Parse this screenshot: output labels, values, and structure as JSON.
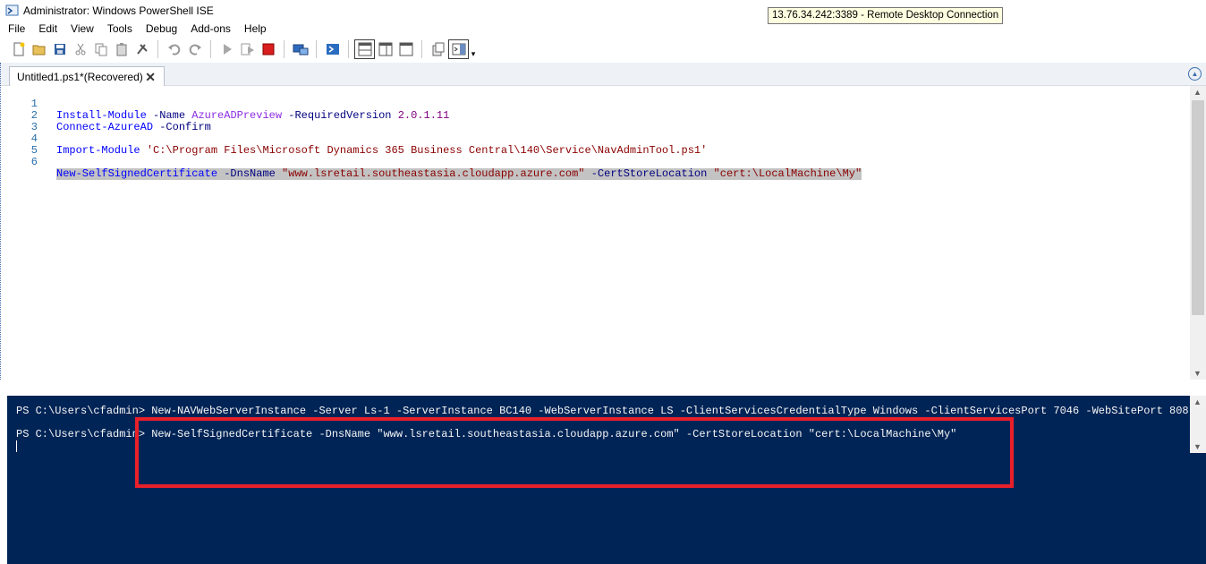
{
  "window": {
    "title": "Administrator: Windows PowerShell ISE",
    "tooltip": "13.76.34.242:3389 - Remote Desktop Connection"
  },
  "menu": [
    "File",
    "Edit",
    "View",
    "Tools",
    "Debug",
    "Add-ons",
    "Help"
  ],
  "toolbar": {
    "icons": [
      "new-file-icon",
      "open-folder-icon",
      "save-icon",
      "cut-icon",
      "copy-icon",
      "paste-icon",
      "clear-icon",
      "undo-icon",
      "redo-icon",
      "run-icon",
      "run-selection-icon",
      "stop-icon",
      "remote-powershell-icon",
      "powershell-console-icon",
      "show-script-top-icon",
      "show-script-right-icon",
      "show-script-max-icon",
      "snippets-icon",
      "command-addon-icon"
    ]
  },
  "tab": {
    "label": "Untitled1.ps1*(Recovered)",
    "close": "✕"
  },
  "editor": {
    "lines": [
      {
        "num": "1",
        "cmd": "Install-Module",
        "rest": [
          {
            "t": " -Name ",
            "c": "param"
          },
          {
            "t": "AzureADPreview",
            "c": "arg"
          },
          {
            "t": " -RequiredVersion ",
            "c": "param"
          },
          {
            "t": "2.0.1.11",
            "c": "num"
          }
        ]
      },
      {
        "num": "2",
        "cmd": "Connect-AzureAD",
        "rest": [
          {
            "t": " -Confirm",
            "c": "param"
          }
        ]
      },
      {
        "num": "3",
        "cmd": "",
        "rest": []
      },
      {
        "num": "4",
        "cmd": "Import-Module",
        "rest": [
          {
            "t": " ",
            "c": "param"
          },
          {
            "t": "'C:\\Program Files\\Microsoft Dynamics 365 Business Central\\140\\Service\\NavAdminTool.ps1'",
            "c": "str"
          }
        ]
      },
      {
        "num": "5",
        "cmd": "",
        "rest": []
      },
      {
        "num": "6",
        "cmd": "New-SelfSignedCertificate",
        "rest": [
          {
            "t": " -DnsName ",
            "c": "param"
          },
          {
            "t": "\"www.lsretail.southeastasia.cloudapp.azure.com\"",
            "c": "str"
          },
          {
            "t": " -CertStoreLocation ",
            "c": "param"
          },
          {
            "t": "\"cert:\\LocalMachine\\My\"",
            "c": "str"
          }
        ],
        "selected": true
      }
    ]
  },
  "console": {
    "line1": "PS C:\\Users\\cfadmin> New-NAVWebServerInstance -Server Ls-1 -ServerInstance BC140 -WebServerInstance LS -ClientServicesCredentialType Windows -ClientServicesPort 7046 -WebSitePort 808",
    "line2": "PS C:\\Users\\cfadmin> New-SelfSignedCertificate -DnsName \"www.lsretail.southeastasia.cloudapp.azure.com\" -CertStoreLocation \"cert:\\LocalMachine\\My\""
  },
  "colors": {
    "console_bg": "#012456",
    "highlight": "#e8202a"
  }
}
